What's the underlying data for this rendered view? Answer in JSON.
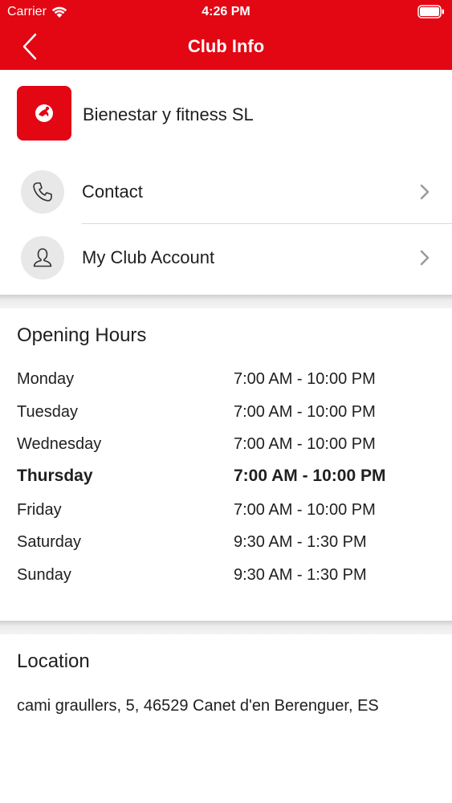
{
  "status_bar": {
    "carrier": "Carrier",
    "time": "4:26 PM",
    "wifi_icon": "wifi-icon",
    "battery_icon": "battery-icon"
  },
  "nav": {
    "title": "Club Info",
    "back_icon": "chevron-left-icon"
  },
  "club": {
    "name": "Bienestar y fitness SL",
    "logo_icon": "club-logo-icon"
  },
  "menu": [
    {
      "label": "Contact",
      "icon": "phone-icon"
    },
    {
      "label": "My Club Account",
      "icon": "person-icon"
    }
  ],
  "opening_hours": {
    "title": "Opening Hours",
    "rows": [
      {
        "day": "Monday",
        "hours": "7:00 AM - 10:00 PM",
        "today": false
      },
      {
        "day": "Tuesday",
        "hours": "7:00 AM - 10:00 PM",
        "today": false
      },
      {
        "day": "Wednesday",
        "hours": "7:00 AM - 10:00 PM",
        "today": false
      },
      {
        "day": "Thursday",
        "hours": "7:00 AM - 10:00 PM",
        "today": true
      },
      {
        "day": "Friday",
        "hours": "7:00 AM - 10:00 PM",
        "today": false
      },
      {
        "day": "Saturday",
        "hours": "9:30 AM - 1:30 PM",
        "today": false
      },
      {
        "day": "Sunday",
        "hours": "9:30 AM - 1:30 PM",
        "today": false
      }
    ]
  },
  "location": {
    "title": "Location",
    "address": "cami graullers, 5, 46529 Canet d'en Berenguer, ES"
  },
  "colors": {
    "brand_red": "#e30613",
    "icon_circle": "#e8e8e8",
    "chevron_gray": "#9a9a9a"
  }
}
